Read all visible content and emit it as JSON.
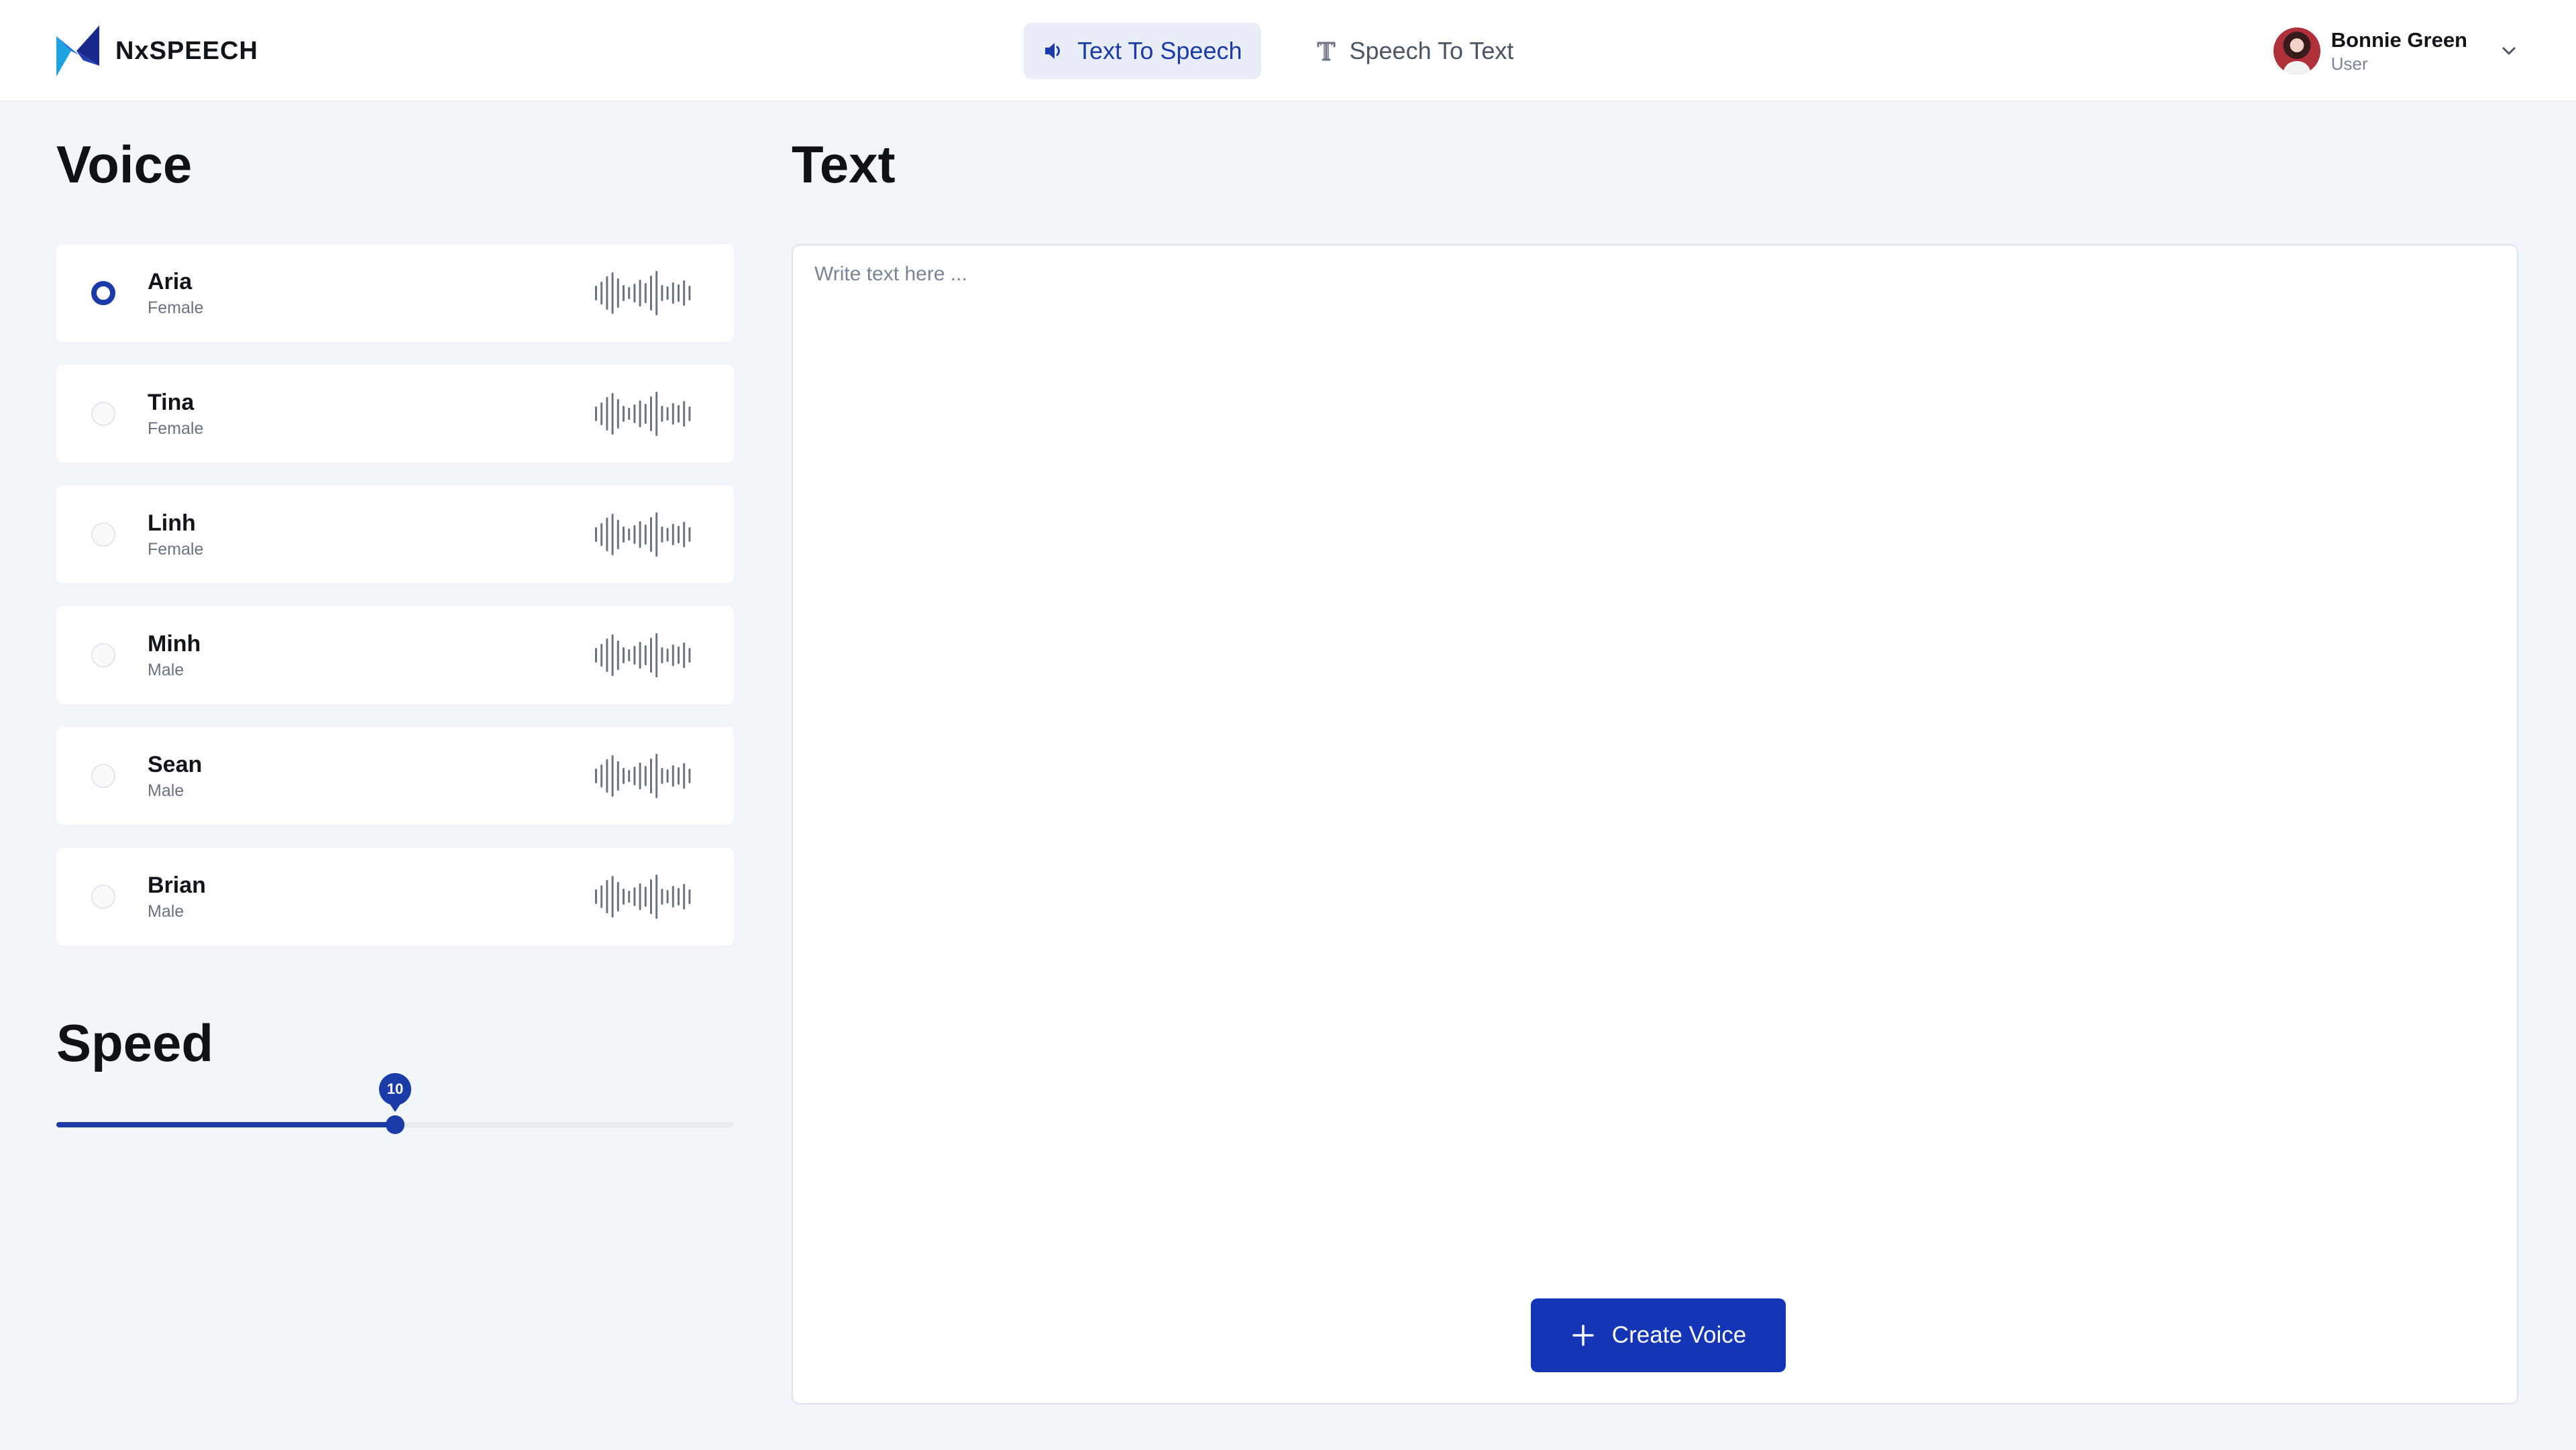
{
  "brand": {
    "name": "NxSPEECH",
    "logo_icon": "nx-logo-icon",
    "colors": {
      "dark": "#1a2a8c",
      "light": "#1fa3e0"
    }
  },
  "nav": {
    "tabs": [
      {
        "label": "Text To Speech",
        "icon": "speaker-icon",
        "active": true
      },
      {
        "label": "Speech To Text",
        "icon": "text-icon",
        "active": false
      }
    ]
  },
  "user": {
    "name": "Bonnie Green",
    "role": "User"
  },
  "voice": {
    "title": "Voice",
    "items": [
      {
        "name": "Aria",
        "gender": "Female",
        "selected": true
      },
      {
        "name": "Tina",
        "gender": "Female",
        "selected": false
      },
      {
        "name": "Linh",
        "gender": "Female",
        "selected": false
      },
      {
        "name": "Minh",
        "gender": "Male",
        "selected": false
      },
      {
        "name": "Sean",
        "gender": "Male",
        "selected": false
      },
      {
        "name": "Brian",
        "gender": "Male",
        "selected": false
      }
    ]
  },
  "speed": {
    "title": "Speed",
    "value": "10",
    "fraction": 0.5
  },
  "text": {
    "title": "Text",
    "value": "",
    "placeholder": "Write text here ...",
    "create_label": "Create Voice"
  },
  "colors": {
    "accent": "#1a3ba8",
    "button": "#1435b5",
    "background": "#f2f5fa",
    "active_tab_bg": "#e8edf8"
  }
}
